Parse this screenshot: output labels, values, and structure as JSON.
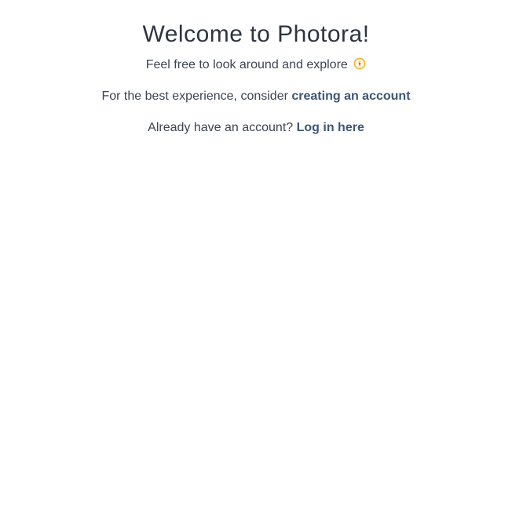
{
  "welcome": {
    "title": "Welcome to Photora!",
    "explore_text": "Feel free to look around and explore",
    "explore_icon": "compass-icon",
    "signup_prefix": "For the best experience, consider",
    "signup_link": "creating an account",
    "login_prefix": "Already have an account?",
    "login_link": "Log in here"
  },
  "colors": {
    "text": "#3c4453",
    "link": "#3d5675",
    "icon": "#f2b531"
  }
}
